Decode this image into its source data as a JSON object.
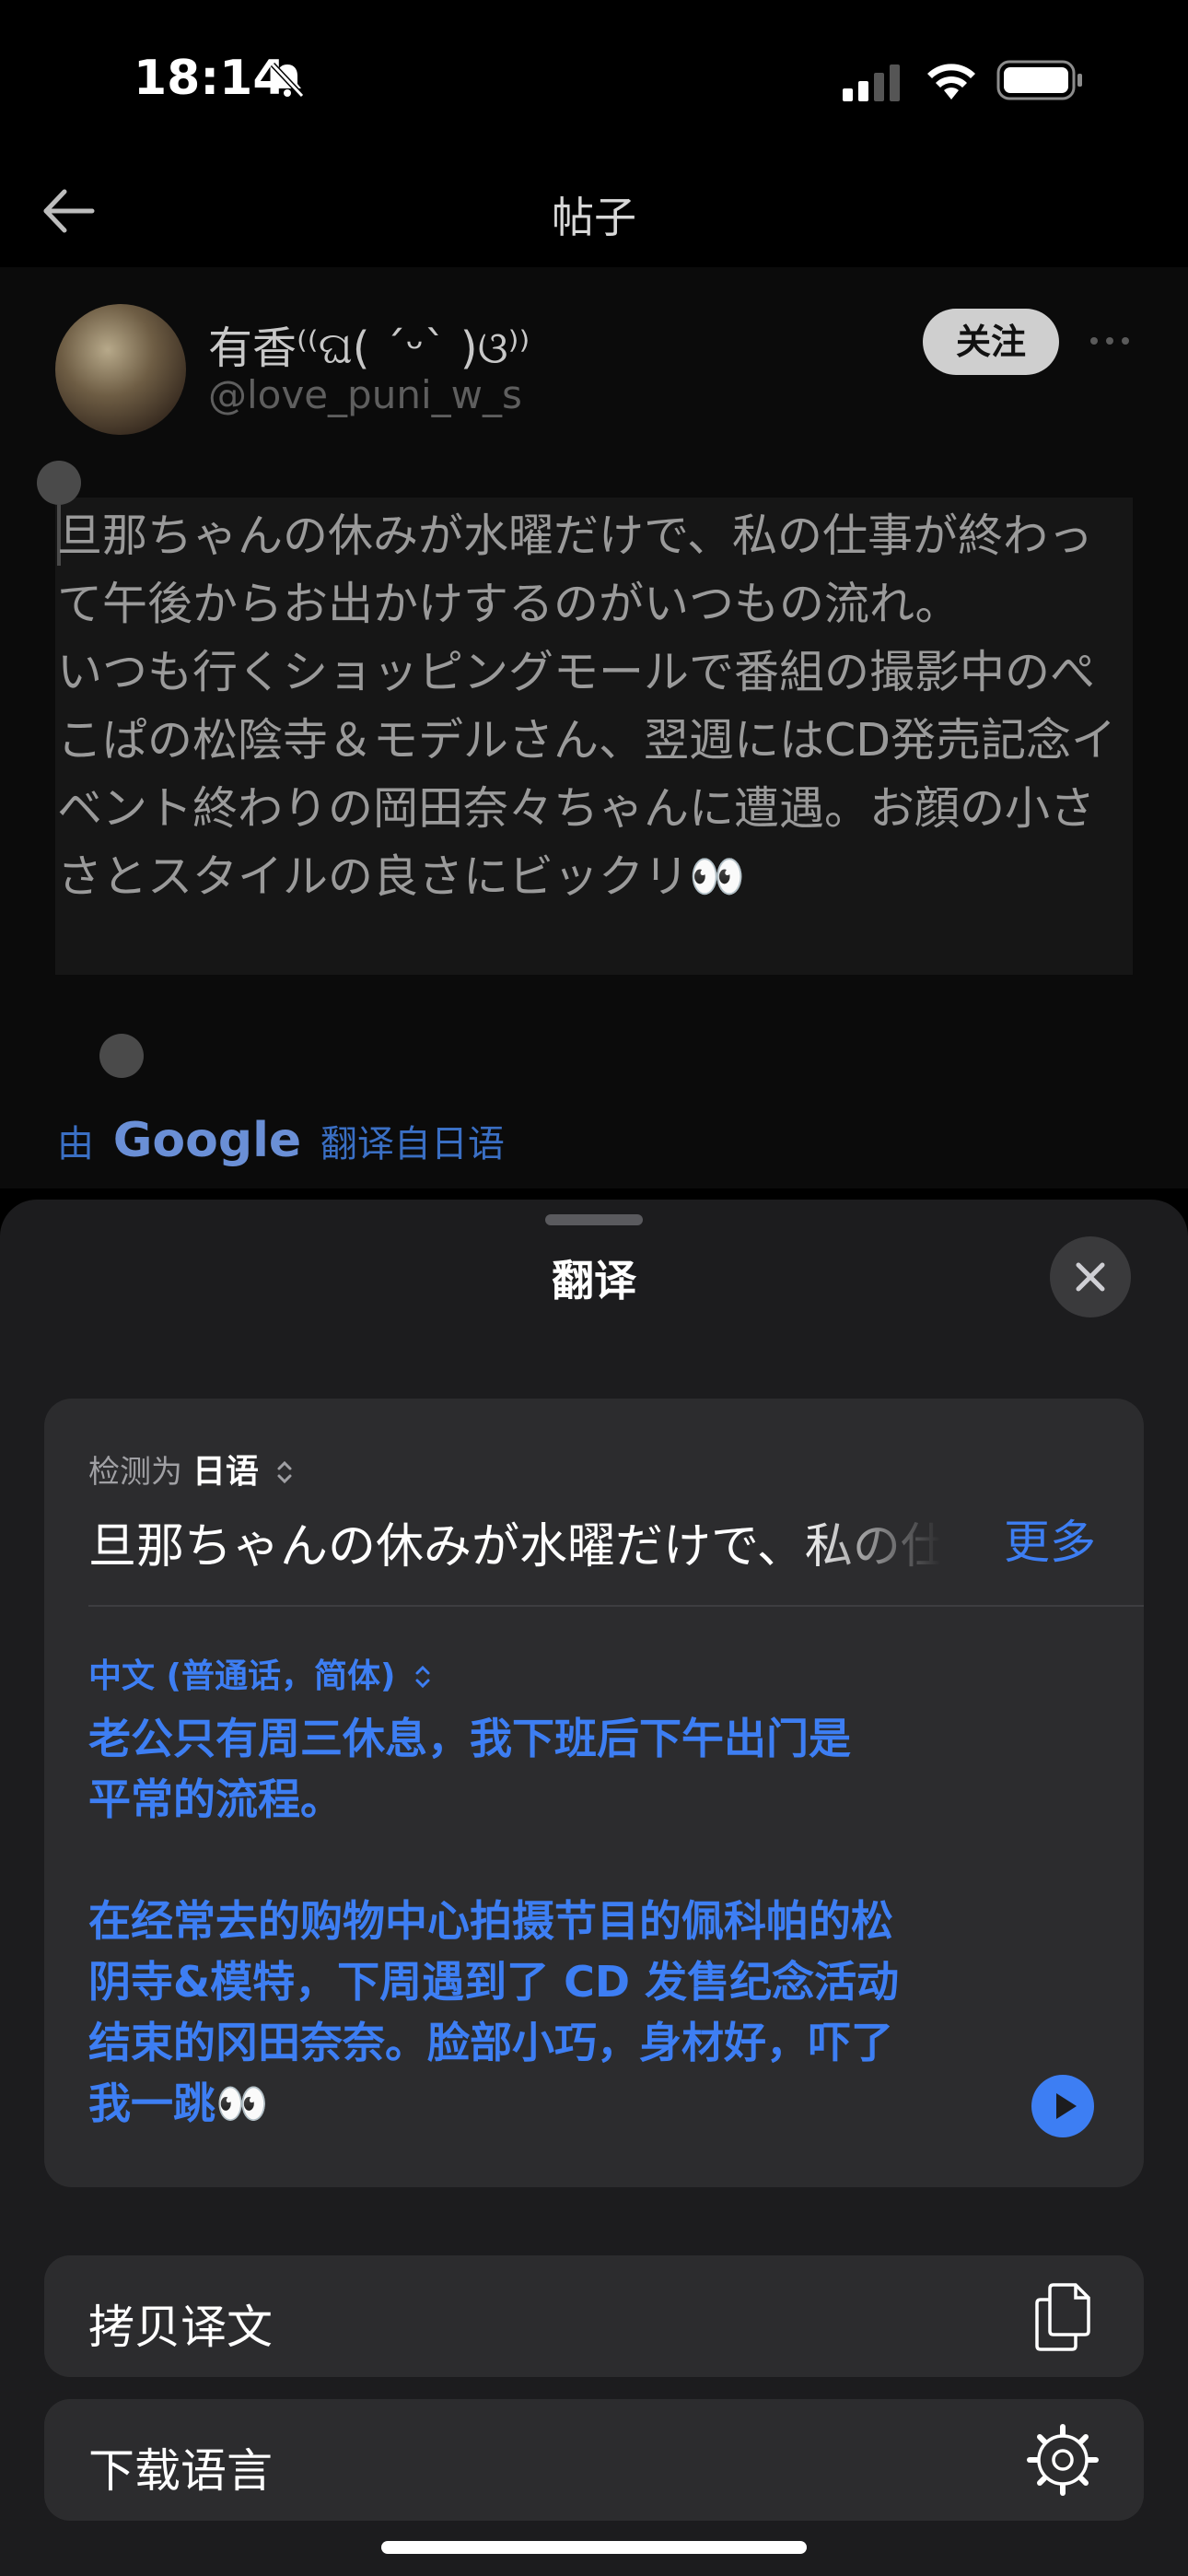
{
  "status_bar": {
    "time": "18:14"
  },
  "nav": {
    "title": "帖子"
  },
  "post": {
    "author_name": "有香⁽⁽ଘ( ˊᵕˋ )ଓ⁾⁾",
    "author_handle": "@love_puni_w_s",
    "follow_label": "关注",
    "text": "旦那ちゃんの休みが水曜だけで、私の仕事が終わって午後からお出かけするのがいつもの流れ。\nいつも行くショッピングモールで番組の撮影中のぺこぱの松陰寺＆モデルさん、翌週にはCD発売記念イベント終わりの岡田奈々ちゃんに遭遇。お顔の小ささとスタイルの良さにビックリ👀",
    "translated_by_prefix": "由",
    "translated_by_brand": "Google",
    "translated_from": "翻译自日语"
  },
  "sheet": {
    "title": "翻译",
    "detected_prefix": "检测为",
    "detected_language": "日语",
    "source_text": "旦那ちゃんの休みが水曜だけで、私の仕事が終わって",
    "more_label": "更多",
    "target_language": "中文 (普通话，简体)",
    "translation": "老公只有周三休息，我下班后下午出门是\n平常的流程。\n\n在经常去的购物中心拍摄节目的佩科帕的松\n阴寺&模特，下周遇到了 CD 发售纪念活动\n结束的冈田奈奈。脸部小巧，身材好，吓了\n我一跳👀",
    "copy_label": "拷贝译文",
    "download_label": "下载语言"
  },
  "colors": {
    "accent": "#3d7ef3",
    "sheet_bg": "#1c1c1e",
    "card_bg": "#2c2c2e"
  }
}
